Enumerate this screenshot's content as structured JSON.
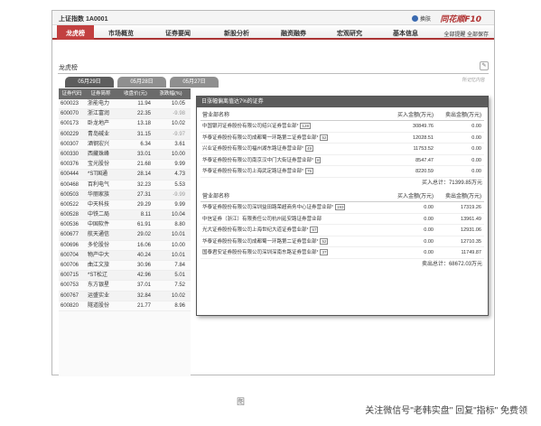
{
  "window": {
    "title": "上证指数 1A0001",
    "login_label": "换肤",
    "logo": "同花顺F10"
  },
  "nav": {
    "items": [
      "龙虎榜",
      "市场概览",
      "证券要闻",
      "新股分析",
      "融资融券",
      "宏观研究",
      "基本信息"
    ],
    "right_text": "全部提醒 全部保存"
  },
  "section": {
    "title": "龙虎榜",
    "note": "所记忆内容",
    "tool_icon": "edit-icon"
  },
  "date_tabs": [
    "05月29日",
    "05月28日",
    "05月27日"
  ],
  "stock_table": {
    "headers": [
      "证券代码",
      "证券简称",
      "收盘价(元)",
      "涨跌幅(%)"
    ],
    "rows": [
      {
        "code": "600023",
        "name": "浙能电力",
        "price": "11.94",
        "pct": "10.05"
      },
      {
        "code": "600070",
        "name": "浙江富润",
        "price": "22.35",
        "pct": "-9.98"
      },
      {
        "code": "600173",
        "name": "卧龙地产",
        "price": "13.18",
        "pct": "10.02"
      },
      {
        "code": "600229",
        "name": "青岛碱业",
        "price": "31.15",
        "pct": "-9.97"
      },
      {
        "code": "600307",
        "name": "酒钢宏兴",
        "price": "6.34",
        "pct": "3.61"
      },
      {
        "code": "600330",
        "name": "西藏珠峰",
        "price": "33.01",
        "pct": "10.00"
      },
      {
        "code": "600376",
        "name": "宝光股份",
        "price": "21.68",
        "pct": "9.99"
      },
      {
        "code": "600444",
        "name": "*ST国通",
        "price": "28.14",
        "pct": "4.73"
      },
      {
        "code": "600468",
        "name": "百利电气",
        "price": "32.23",
        "pct": "5.53"
      },
      {
        "code": "600503",
        "name": "华丽家族",
        "price": "27.31",
        "pct": "-9.99"
      },
      {
        "code": "600522",
        "name": "中天科技",
        "price": "29.29",
        "pct": "9.99"
      },
      {
        "code": "600528",
        "name": "中铁二局",
        "price": "8.11",
        "pct": "10.04"
      },
      {
        "code": "600536",
        "name": "中国软件",
        "price": "61.91",
        "pct": "8.80"
      },
      {
        "code": "600677",
        "name": "航天通信",
        "price": "29.02",
        "pct": "10.01"
      },
      {
        "code": "600696",
        "name": "多伦股份",
        "price": "16.06",
        "pct": "10.00"
      },
      {
        "code": "600704",
        "name": "物产中大",
        "price": "40.24",
        "pct": "10.01"
      },
      {
        "code": "600706",
        "name": "曲江文旅",
        "price": "30.96",
        "pct": "7.84"
      },
      {
        "code": "600715",
        "name": "*ST松辽",
        "price": "42.96",
        "pct": "5.01"
      },
      {
        "code": "600753",
        "name": "东方银星",
        "price": "37.01",
        "pct": "7.52"
      },
      {
        "code": "600767",
        "name": "运盛实业",
        "price": "32.84",
        "pct": "10.02"
      },
      {
        "code": "600820",
        "name": "隧道股份",
        "price": "21.77",
        "pct": "8.96"
      }
    ]
  },
  "popup": {
    "title": "日涨幅偏离值达7%的证券",
    "buy_section": {
      "headers": [
        "营业部名称",
        "买入金额(万元)",
        "卖出金额(万元)"
      ],
      "rows": [
        {
          "name": "中国银河证券股份有限公司绍兴证券营业部",
          "badge": "128",
          "buy": "30849.76",
          "sell": "0.00"
        },
        {
          "name": "华泰证券股份有限公司成都蜀一环路第二证券营业部",
          "badge": "52",
          "buy": "12028.51",
          "sell": "0.00"
        },
        {
          "name": "兴业证券股份有限公司福州湖东路证券营业部",
          "badge": "49",
          "buy": "11753.52",
          "sell": "0.00"
        },
        {
          "name": "华泰证券股份有限公司南京汉中门大街证券营业部",
          "badge": "8",
          "buy": "8547.47",
          "sell": "0.00"
        },
        {
          "name": "华泰证券股份有限公司上海武定路证券营业部",
          "badge": "75",
          "buy": "8220.59",
          "sell": "0.00"
        }
      ],
      "total": "买入总计：71399.85万元"
    },
    "sell_section": {
      "headers": [
        "营业部名称",
        "买入金额(万元)",
        "卖出金额(万元)"
      ],
      "rows": [
        {
          "name": "华泰证券股份有限公司深圳益田路荣超商务中心证券营业部",
          "badge": "193",
          "buy": "0.00",
          "sell": "17319.26"
        },
        {
          "name": "中信证券（浙江）有限责任公司杭州延安路证券营业部",
          "badge": "",
          "buy": "0.00",
          "sell": "13961.49"
        },
        {
          "name": "光大证券股份有限公司上海世纪大道证券营业部",
          "badge": "67",
          "buy": "0.00",
          "sell": "12931.06"
        },
        {
          "name": "华泰证券股份有限公司成都蜀一环路第二证券营业部",
          "badge": "52",
          "buy": "0.00",
          "sell": "12710.35"
        },
        {
          "name": "国泰君安证券股份有限公司深圳深南东路证券营业部",
          "badge": "37",
          "buy": "0.00",
          "sell": "11749.87"
        }
      ],
      "total": "卖出总计：68672.03万元"
    }
  },
  "caption": "图",
  "watermark": "关注微信号\"老韩实盘\" 回复\"指标\" 免费领"
}
